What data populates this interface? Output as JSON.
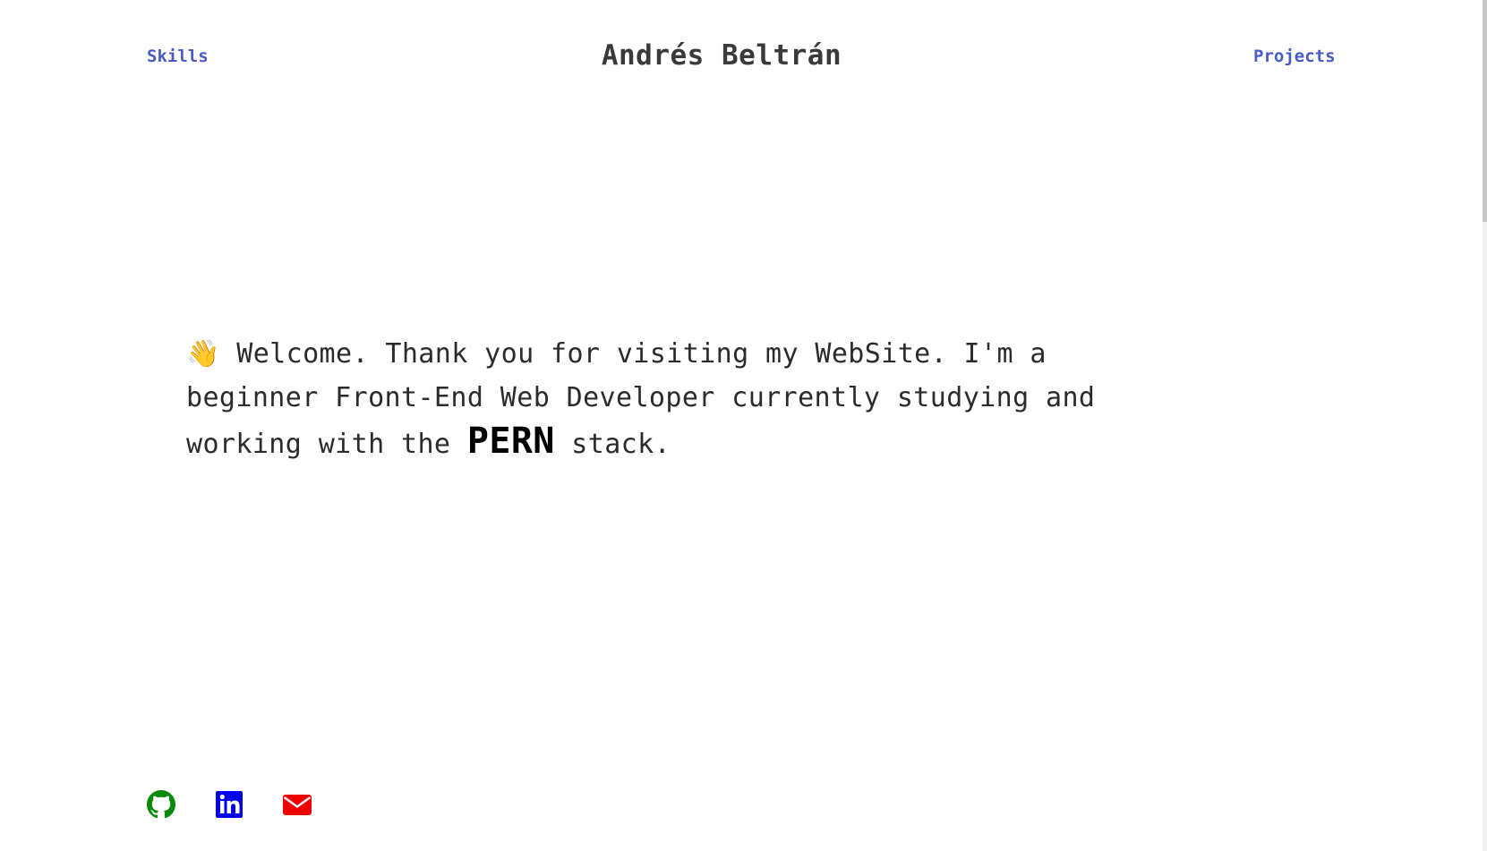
{
  "header": {
    "left_link": "Skills",
    "title": "Andrés Beltrán",
    "right_link": "Projects"
  },
  "intro": {
    "emoji": "👋",
    "text_before": "Welcome. Thank you for visiting my WebSite. I'm a beginner Front-End Web Developer currently studying and working with the",
    "highlight": "PERN",
    "text_after": "stack."
  },
  "social": {
    "github": {
      "icon": "github-icon",
      "color": "#0a8a0a"
    },
    "linkedin": {
      "icon": "linkedin-icon",
      "color": "#0000ee"
    },
    "email": {
      "icon": "envelope-icon",
      "color": "#ee0000"
    }
  },
  "colors": {
    "nav_link": "#4a5cc4",
    "title": "#3a3a3a",
    "body_text": "#2b2b2b"
  }
}
